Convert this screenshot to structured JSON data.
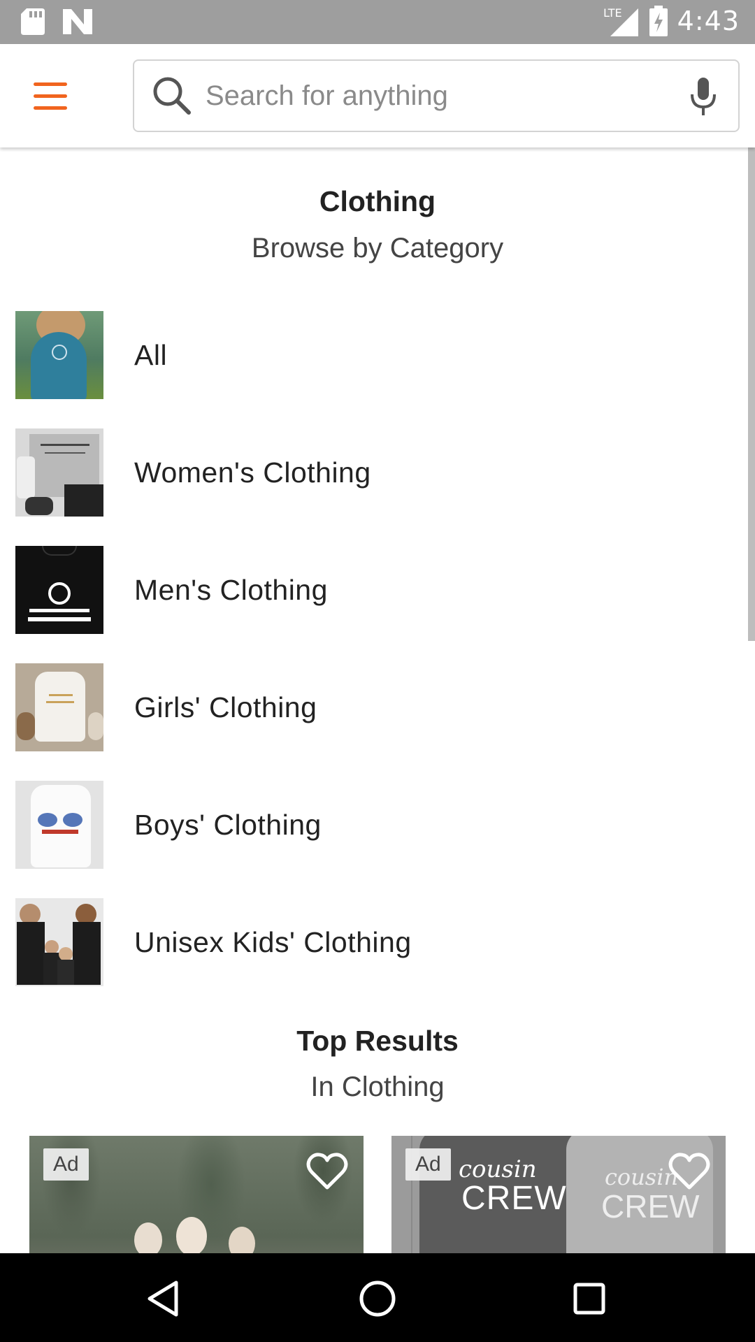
{
  "status_bar": {
    "time": "4:43",
    "network": "LTE",
    "icons": [
      "sd-card-icon",
      "n-notification-icon",
      "signal-icon",
      "battery-charging-icon"
    ]
  },
  "app_bar": {
    "menu_icon": "hamburger-menu-icon",
    "search": {
      "placeholder": "Search for anything",
      "value": ""
    },
    "accent_color": "#f1641e"
  },
  "category_header": {
    "title": "Clothing",
    "subtitle": "Browse by Category"
  },
  "categories": [
    {
      "label": "All"
    },
    {
      "label": "Women's Clothing"
    },
    {
      "label": "Men's Clothing"
    },
    {
      "label": "Girls' Clothing"
    },
    {
      "label": "Boys' Clothing"
    },
    {
      "label": "Unisex Kids' Clothing"
    }
  ],
  "results_header": {
    "title": "Top Results",
    "subtitle": "In Clothing"
  },
  "listings": [
    {
      "badge": "Ad",
      "icon": "heart-icon"
    },
    {
      "badge": "Ad",
      "icon": "heart-icon",
      "shirt_text_1": "cousin",
      "shirt_text_2": "CREW"
    }
  ],
  "nav_bar": {
    "icons": [
      "back-icon",
      "home-icon",
      "recents-icon"
    ]
  }
}
